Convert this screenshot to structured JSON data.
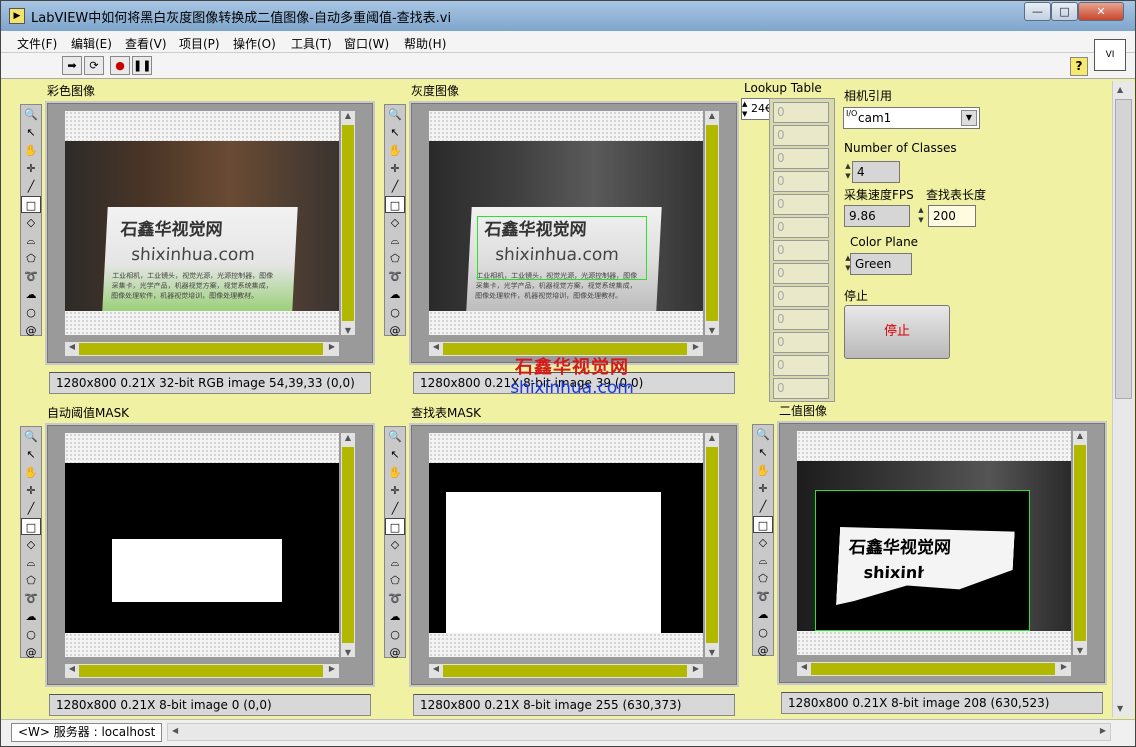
{
  "window": {
    "title": "LabVIEW中如何将黑白灰度图像转换成二值图像-自动多重阈值-查找表.vi",
    "min": "—",
    "max": "□",
    "close": "✕"
  },
  "menu": [
    "文件(F)",
    "编辑(E)",
    "查看(V)",
    "项目(P)",
    "操作(O)",
    "工具(T)",
    "窗口(W)",
    "帮助(H)"
  ],
  "toolbar": {
    "run_icon": "run-arrow-icon",
    "cont_icon": "run-continuously-icon",
    "abort_icon": "abort-icon",
    "pause_icon": "pause-icon",
    "help": "?",
    "vi_icon": "VI"
  },
  "panels": {
    "color": {
      "label": "彩色图像",
      "info": "1280x800 0.21X 32-bit RGB image 54,39,33     (0,0)"
    },
    "gray": {
      "label": "灰度图像",
      "info": "1280x800 0.21X 8-bit image 39     (0,0)"
    },
    "automask": {
      "label": "自动阈值MASK",
      "info": "1280x800 0.21X 8-bit image 0     (0,0)"
    },
    "lutmask": {
      "label": "查找表MASK",
      "info": "1280x800 0.21X 8-bit image 255     (630,373)"
    },
    "binary": {
      "label": "二值图像",
      "info": "1280x800 0.21X 8-bit image 208     (630,523)"
    }
  },
  "photo": {
    "logo": "石鑫华视觉网",
    "site": "shixinhua.com",
    "line1": "工业相机，工业镜头，视觉光源，光源控制器，图像",
    "line2": "采集卡，光学产品，机器视觉方案，视觉系统集成，",
    "line3": "图像处理软件，机器视觉培训，图像处理教材。"
  },
  "lookup": {
    "label": "Lookup Table",
    "index": "24€",
    "cells": [
      "0",
      "0",
      "0",
      "0",
      "0",
      "0",
      "0",
      "0",
      "0",
      "0",
      "0",
      "0",
      "0"
    ]
  },
  "camera": {
    "label": "相机引用",
    "value": "cam1",
    "io_icon": "I/O"
  },
  "classes": {
    "label": "Number of Classes",
    "value": "4"
  },
  "fps": {
    "label": "采集速度FPS",
    "value": "9.86"
  },
  "lutlen": {
    "label": "查找表长度",
    "value": "200"
  },
  "plane": {
    "label": "Color Plane",
    "value": "Green"
  },
  "stop": {
    "label": "停止",
    "button": "停止"
  },
  "status": {
    "server": "<W> 服务器 : localhost"
  },
  "watermark": {
    "logo": "石鑫华视觉网",
    "url": "shixinhua.com"
  },
  "colors": {
    "background": "#f1f1a3",
    "scroll_thumb": "#b2b800",
    "stop_text": "#e00000"
  }
}
